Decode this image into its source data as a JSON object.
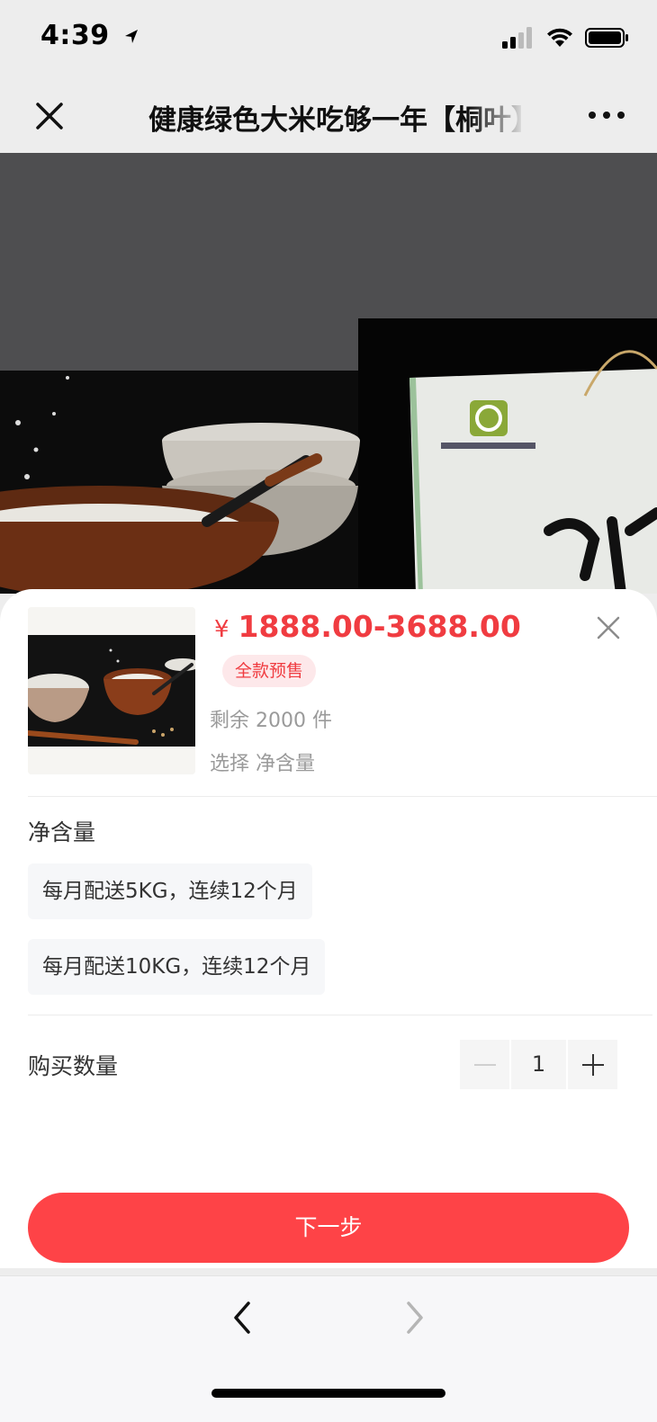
{
  "status_bar": {
    "time": "4:39",
    "icons": [
      "location-arrow-icon",
      "cellular-signal-icon",
      "wifi-icon",
      "battery-icon"
    ]
  },
  "nav": {
    "title": "健康绿色大米吃够一年【桐叶】",
    "close_icon": "close-icon",
    "more_icon": "more-icon"
  },
  "product": {
    "currency": "¥",
    "price_range": "1888.00-3688.00",
    "badge": "全款预售",
    "stock_text": "剩余 2000 件",
    "select_hint": "选择 净含量"
  },
  "spec": {
    "title": "净含量",
    "options": [
      "每月配送5KG，连续12个月",
      "每月配送10KG，连续12个月"
    ]
  },
  "quantity": {
    "label": "购买数量",
    "value": "1"
  },
  "actions": {
    "next_label": "下一步"
  },
  "colors": {
    "accent": "#fe4347",
    "price": "#f03c41",
    "badge_bg": "#fde8ea"
  }
}
